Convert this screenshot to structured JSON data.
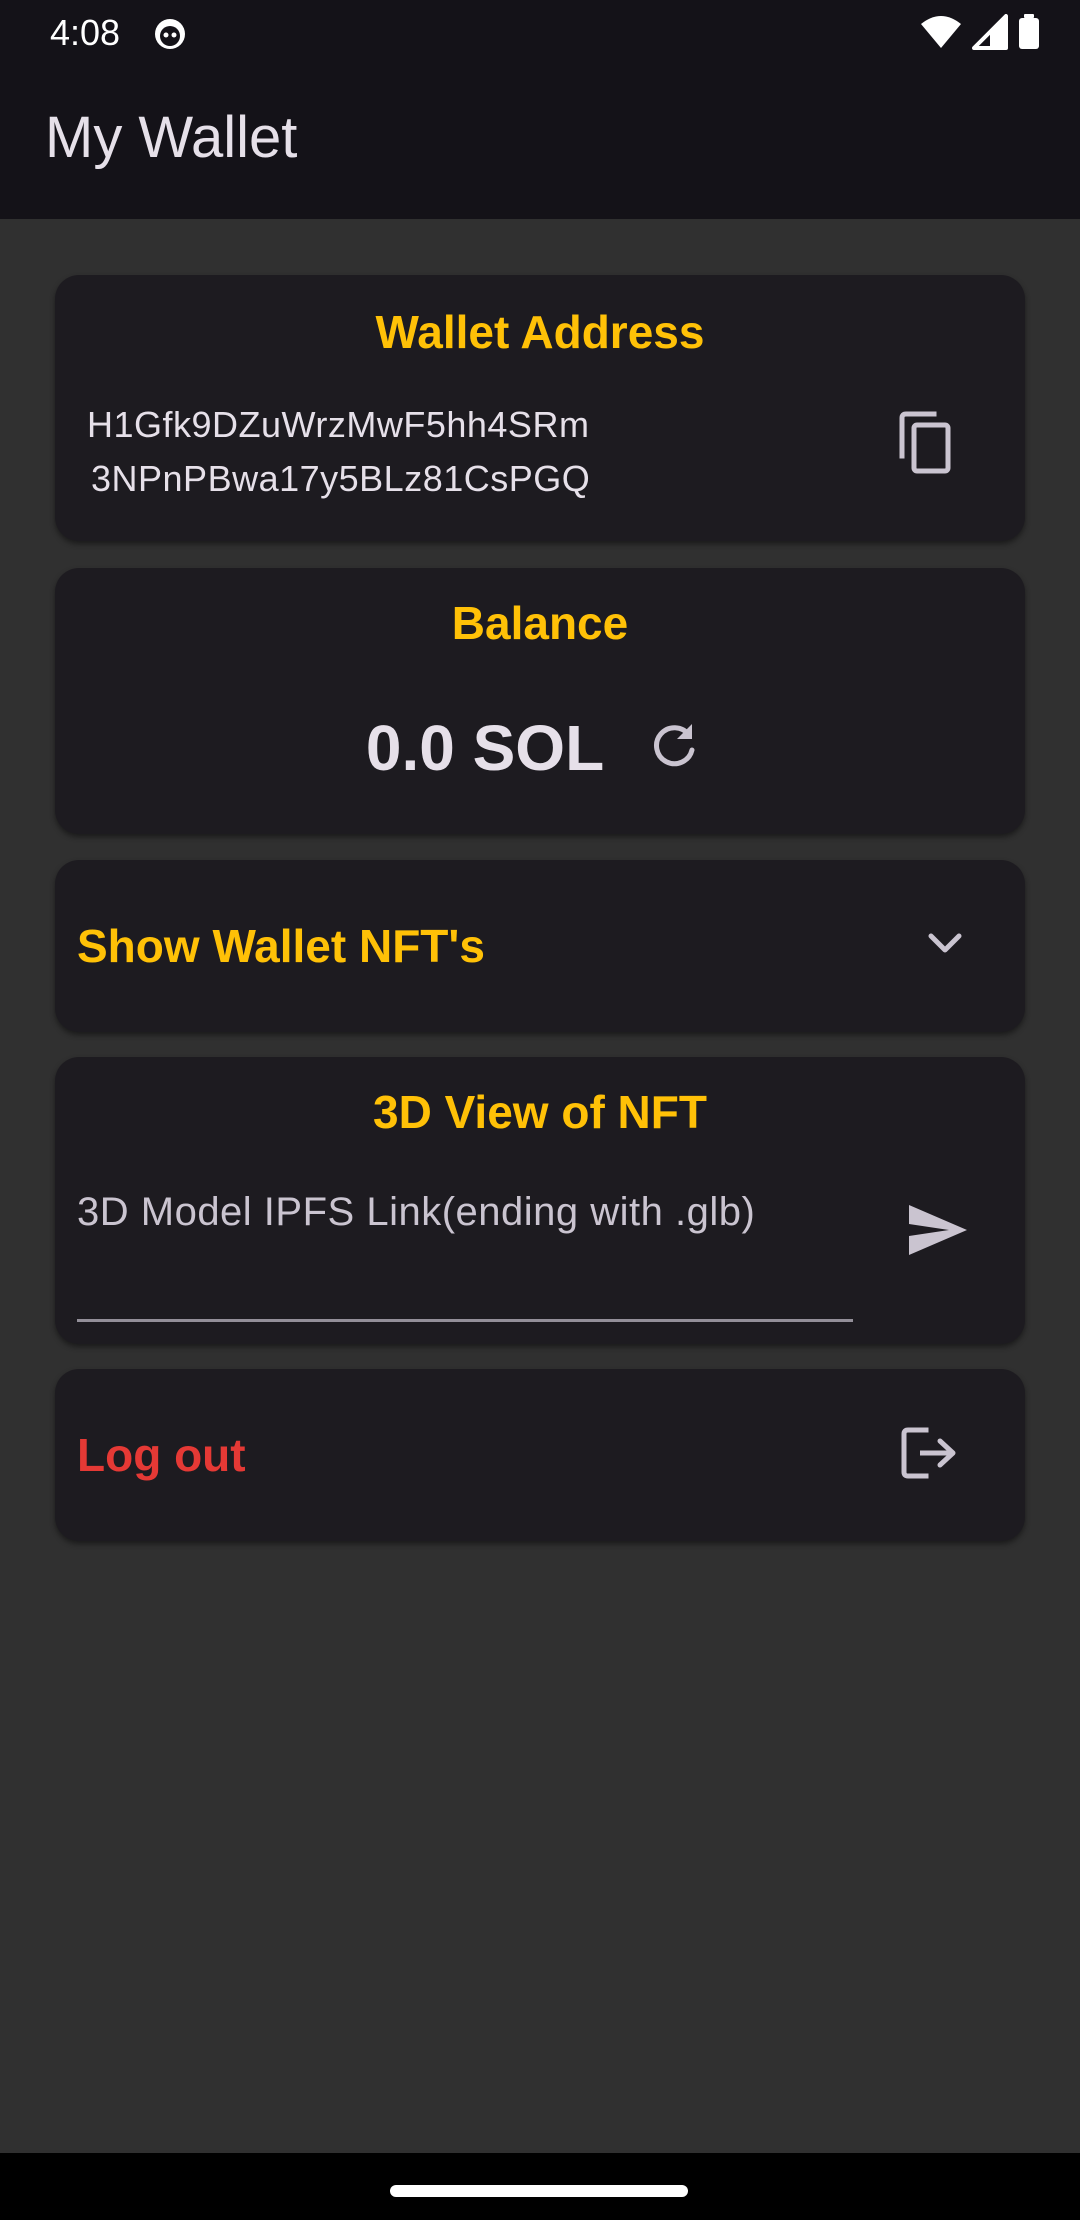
{
  "status_bar": {
    "time": "4:08",
    "icons": [
      "notification-cat-icon",
      "wifi-icon",
      "signal-icon",
      "battery-icon"
    ]
  },
  "app_bar": {
    "title": "My Wallet"
  },
  "wallet_address": {
    "title": "Wallet Address",
    "line1": "H1Gfk9DZuWrzMwF5hh4SRm",
    "line2": "3NPnPBwa17y5BLz81CsPGQ",
    "copy_icon": "copy-icon"
  },
  "balance": {
    "title": "Balance",
    "value": "0.0 SOL",
    "refresh_icon": "refresh-icon"
  },
  "nfts": {
    "label": "Show Wallet NFT's",
    "expand_icon": "chevron-down-icon"
  },
  "viewer": {
    "title": "3D View of NFT",
    "placeholder": "3D Model IPFS Link(ending with .glb)",
    "send_icon": "send-icon"
  },
  "logout": {
    "label": "Log out",
    "icon": "logout-icon"
  },
  "colors": {
    "accent": "#ffc107",
    "danger": "#e53935",
    "card": "#1d1b20",
    "background": "#303030",
    "app_bar": "#141218"
  }
}
